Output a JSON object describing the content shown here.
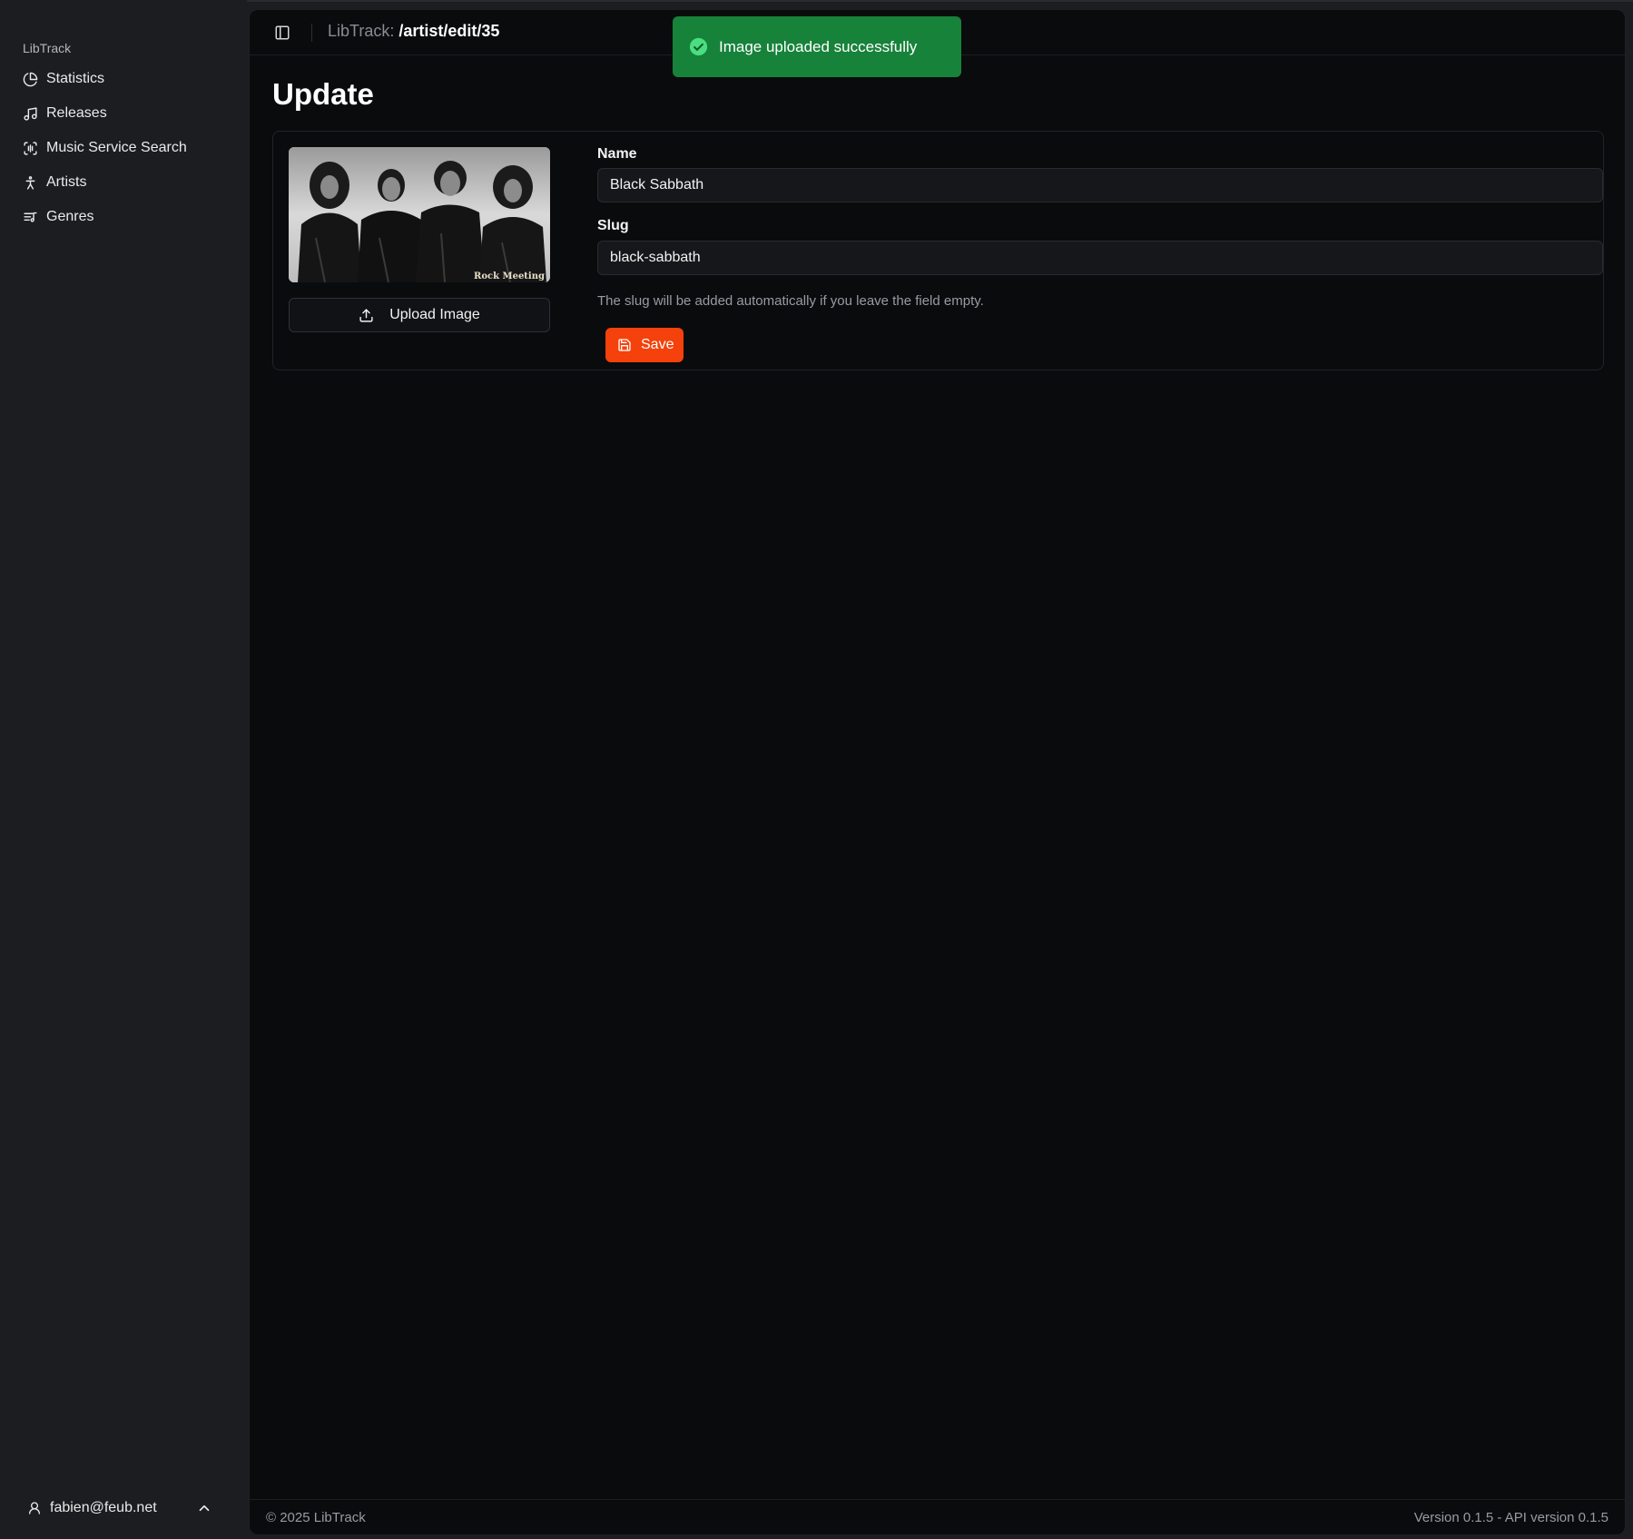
{
  "sidebar": {
    "brand": "LibTrack",
    "items": [
      {
        "label": "Statistics",
        "icon": "pie-chart-icon"
      },
      {
        "label": "Releases",
        "icon": "music-note-icon"
      },
      {
        "label": "Music Service Search",
        "icon": "scan-audio-icon"
      },
      {
        "label": "Artists",
        "icon": "person-icon"
      },
      {
        "label": "Genres",
        "icon": "list-music-icon"
      }
    ],
    "user": {
      "email": "fabien@feub.net",
      "icon": "user-icon"
    }
  },
  "header": {
    "app": "LibTrack:",
    "path": "/artist/edit/35"
  },
  "toast": {
    "message": "Image uploaded successfully",
    "color": "#17823a"
  },
  "page": {
    "title": "Update"
  },
  "form": {
    "upload_label": "Upload Image",
    "name_label": "Name",
    "name_value": "Black Sabbath",
    "slug_label": "Slug",
    "slug_value": "black-sabbath",
    "slug_hint": "The slug will be added automatically if you leave the field empty.",
    "save_label": "Save",
    "save_color": "#f5410b",
    "photo_watermark": "Rock Meeting"
  },
  "footer": {
    "copyright": "© 2025 LibTrack",
    "version": "Version 0.1.5 - API version 0.1.5"
  }
}
